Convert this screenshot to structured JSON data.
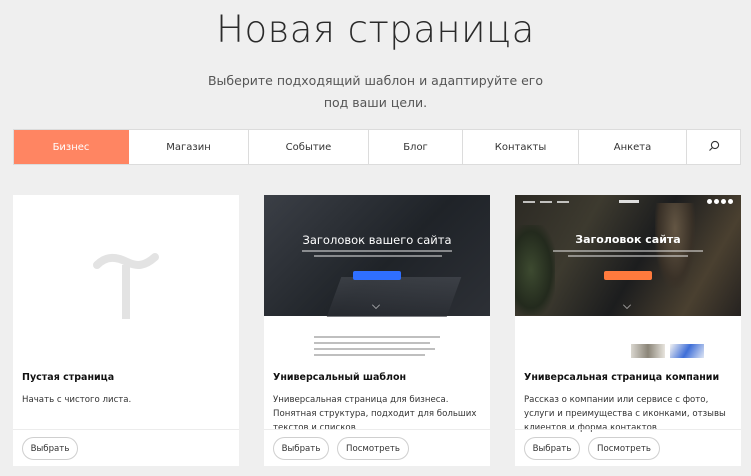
{
  "header": {
    "title": "Новая страница",
    "subtitle": "Выберите подходящий шаблон и адаптируйте его под ваши цели."
  },
  "tabs": [
    {
      "label": "Бизнес",
      "active": true
    },
    {
      "label": "Магазин",
      "active": false
    },
    {
      "label": "Событие",
      "active": false
    },
    {
      "label": "Блог",
      "active": false
    },
    {
      "label": "Контакты",
      "active": false
    },
    {
      "label": "Анкета",
      "active": false
    }
  ],
  "search_icon": "search-icon",
  "colors": {
    "accent": "#ff8562",
    "hero_button_blue": "#2f6fff",
    "hero_button_orange": "#ff7a3d",
    "background": "#efefef"
  },
  "cards": [
    {
      "title": "Пустая страница",
      "description": "Начать с чистого листа.",
      "select_label": "Выбрать",
      "preview_icon": "tilda-logo-icon"
    },
    {
      "title": "Универсальный шаблон",
      "description": "Универсальная страница для бизнеса. Понятная структура, подходит для больших текстов и списков",
      "select_label": "Выбрать",
      "preview_label": "Посмотреть",
      "preview_heading": "Заголовок вашего сайта"
    },
    {
      "title": "Универсальная страница компании",
      "description": "Рассказ о компании или сервисе с фото, услуги и преимущества с иконками, отзывы клиентов и форма контактов",
      "select_label": "Выбрать",
      "preview_label": "Посмотреть",
      "preview_heading": "Заголовок сайта"
    }
  ]
}
